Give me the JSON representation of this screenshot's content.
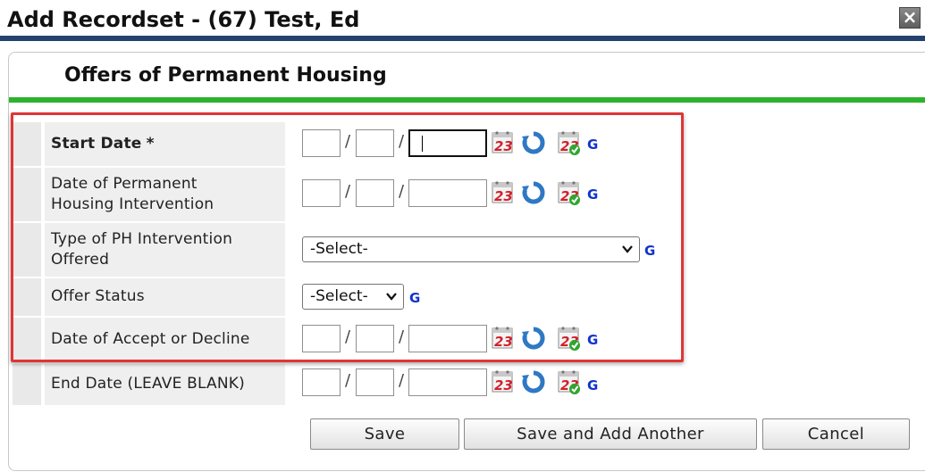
{
  "window": {
    "title": "Add Recordset - (67) Test, Ed",
    "close_glyph": "×"
  },
  "section": {
    "title": "Offers of Permanent Housing"
  },
  "date_separator": "/",
  "g_label": "G",
  "fields": {
    "start_date": {
      "label": "Start Date",
      "required_marker": "*"
    },
    "ph_intervention_date": {
      "label_line1": "Date of Permanent",
      "label_line2": "Housing Intervention"
    },
    "ph_intervention_type": {
      "label_line1": "Type of PH Intervention",
      "label_line2": "Offered",
      "selected": "-Select-"
    },
    "offer_status": {
      "label": "Offer Status",
      "selected": "-Select-"
    },
    "accept_decline_date": {
      "label": "Date of Accept or Decline"
    },
    "end_date": {
      "label": "End Date (LEAVE BLANK)"
    }
  },
  "buttons": {
    "save": "Save",
    "save_add": "Save and Add Another",
    "cancel": "Cancel"
  },
  "colors": {
    "header_bar": "#24426e",
    "section_bar": "#2db22d",
    "highlight": "#e03535",
    "g_link": "#1133cc"
  },
  "icons": [
    "calendar-icon",
    "refresh-icon",
    "calendar-check-icon",
    "chevron-down-icon",
    "close-icon"
  ]
}
